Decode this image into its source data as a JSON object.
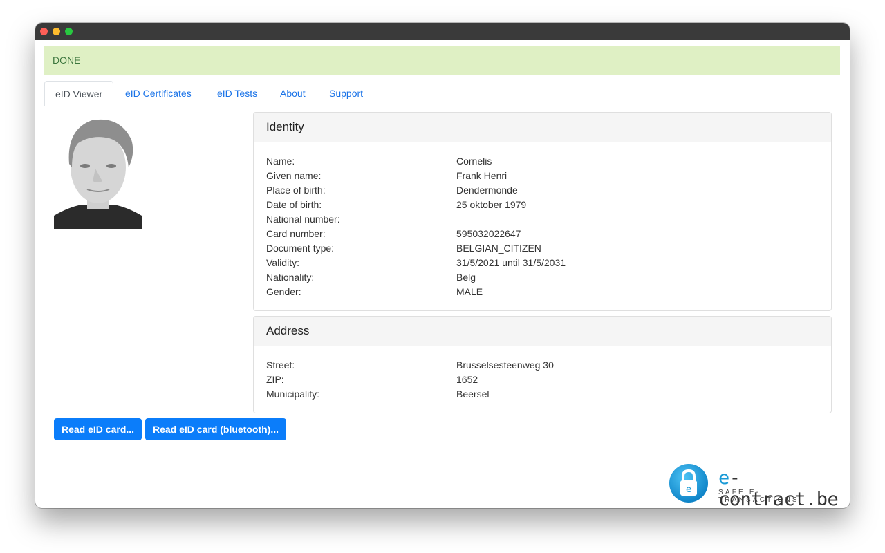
{
  "window": {
    "controls": [
      "close",
      "minimize",
      "maximize"
    ]
  },
  "status": {
    "text": "DONE",
    "color": "#dff0c4"
  },
  "tabs": [
    {
      "label": "eID Viewer",
      "active": true
    },
    {
      "label": "eID Certificates",
      "active": false
    },
    {
      "label": "eID Tests",
      "active": false
    },
    {
      "label": "About",
      "active": false
    },
    {
      "label": "Support",
      "active": false
    }
  ],
  "photo": {
    "alt": "eID card holder photo",
    "icon": "person-photo"
  },
  "identity": {
    "title": "Identity",
    "rows": [
      {
        "label": "Name:",
        "value": "Cornelis"
      },
      {
        "label": "Given name:",
        "value": "Frank Henri"
      },
      {
        "label": "Place of birth:",
        "value": "Dendermonde"
      },
      {
        "label": "Date of birth:",
        "value": "25 oktober 1979"
      },
      {
        "label": "National number:",
        "value": ""
      },
      {
        "label": "Card number:",
        "value": "595032022647"
      },
      {
        "label": "Document type:",
        "value": "BELGIAN_CITIZEN"
      },
      {
        "label": "Validity:",
        "value": "31/5/2021 until 31/5/2031"
      },
      {
        "label": "Nationality:",
        "value": "Belg"
      },
      {
        "label": "Gender:",
        "value": "MALE"
      }
    ]
  },
  "address": {
    "title": "Address",
    "rows": [
      {
        "label": "Street:",
        "value": "Brusselsesteenweg 30"
      },
      {
        "label": "ZIP:",
        "value": "1652"
      },
      {
        "label": "Municipality:",
        "value": "Beersel"
      }
    ]
  },
  "buttons": {
    "read_card": "Read eID card...",
    "read_card_bluetooth": "Read eID card (bluetooth)..."
  },
  "logo": {
    "prefix": "e",
    "name": "-contract.be",
    "tagline": "SAFE E-TRANSACTIONS",
    "badge_letter": "e",
    "brand_color": "#1a9ad6"
  }
}
